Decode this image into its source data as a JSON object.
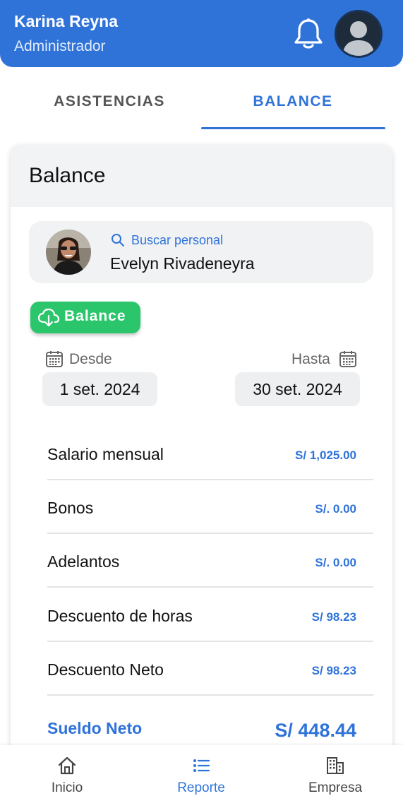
{
  "header": {
    "user_name": "Karina Reyna",
    "user_role": "Administrador",
    "color": "#2f73d9"
  },
  "tabs": [
    {
      "label": "ASISTENCIAS",
      "active": false
    },
    {
      "label": "BALANCE",
      "active": true
    }
  ],
  "card": {
    "title": "Balance",
    "search": {
      "label": "Buscar personal",
      "selected_person": "Evelyn Rivadeneyra"
    },
    "download_button": {
      "label": "Balance",
      "color": "#2bc66c",
      "icon": "cloud-download-icon"
    },
    "range": {
      "from_label": "Desde",
      "from_value": "1 set. 2024",
      "to_label": "Hasta",
      "to_value": "30 set. 2024"
    },
    "rows": [
      {
        "label": "Salario mensual",
        "value": "S/ 1,025.00"
      },
      {
        "label": "Bonos",
        "value": "S/. 0.00"
      },
      {
        "label": "Adelantos",
        "value": "S/. 0.00"
      },
      {
        "label": "Descuento de horas",
        "value": "S/ 98.23"
      },
      {
        "label": "Descuento Neto",
        "value": "S/ 98.23"
      }
    ],
    "net": {
      "label": "Sueldo Neto",
      "value": "S/ 448.44"
    }
  },
  "bottom_nav": [
    {
      "label": "Inicio",
      "icon": "home-icon",
      "active": false
    },
    {
      "label": "Reporte",
      "icon": "list-icon",
      "active": true
    },
    {
      "label": "Empresa",
      "icon": "building-icon",
      "active": false
    }
  ]
}
